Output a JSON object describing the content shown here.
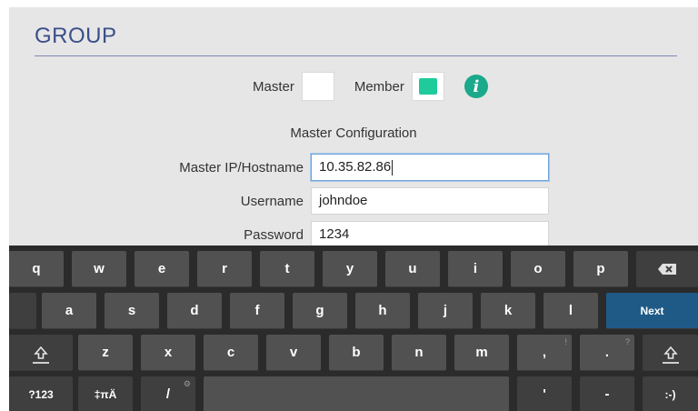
{
  "header": {
    "title": "GROUP"
  },
  "role": {
    "master_label": "Master",
    "member_label": "Member",
    "master_checked": false,
    "member_checked": true
  },
  "config": {
    "section_title": "Master Configuration",
    "fields": [
      {
        "label": "Master IP/Hostname",
        "value": "10.35.82.86",
        "focused": true
      },
      {
        "label": "Username",
        "value": "johndoe",
        "focused": false
      },
      {
        "label": "Password",
        "value": "1234",
        "focused": false
      }
    ]
  },
  "keyboard": {
    "row1": [
      "q",
      "w",
      "e",
      "r",
      "t",
      "y",
      "u",
      "i",
      "o",
      "p"
    ],
    "row2": [
      "a",
      "s",
      "d",
      "f",
      "g",
      "h",
      "j",
      "k",
      "l"
    ],
    "row3": [
      "z",
      "x",
      "c",
      "v",
      "b",
      "n",
      "m"
    ],
    "punct_hints": {
      "comma_hint": "!",
      "period_hint": "?"
    },
    "row3_extra": [
      ",",
      "."
    ],
    "next_label": "Next",
    "row4": {
      "symbols_label": "?123",
      "lang_label": "‡πÄ",
      "slash_label": "/",
      "apostrophe_label": "'",
      "dash_label": "-",
      "smiley_label": ":-)"
    },
    "icons": {
      "backspace": "backspace-icon",
      "shift": "shift-icon",
      "settings": "gear-icon"
    },
    "colors": {
      "key": "#515151",
      "background": "#2b2b2b",
      "next": "#1f5a87"
    }
  },
  "colors": {
    "title": "#3a4f8a",
    "checkbox_on": "#1fcb9b",
    "info": "#1aa98a"
  }
}
